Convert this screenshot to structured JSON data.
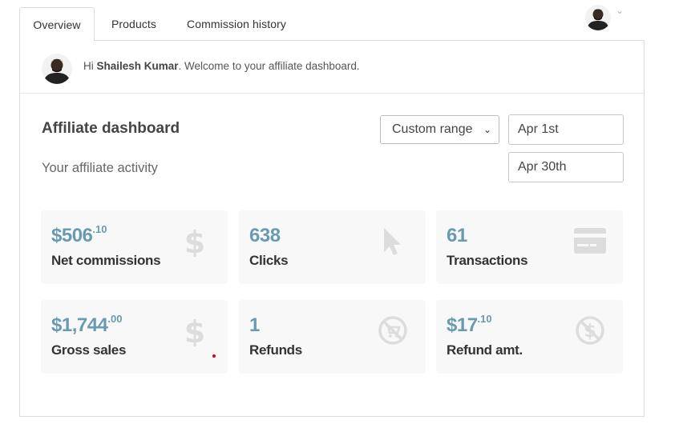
{
  "tabs": [
    {
      "label": "Overview",
      "active": true
    },
    {
      "label": "Products",
      "active": false
    },
    {
      "label": "Commission history",
      "active": false
    }
  ],
  "welcome": {
    "greeting": "Hi ",
    "user_name": "Shailesh Kumar",
    "message": ". Welcome to your affiliate dashboard."
  },
  "dashboard": {
    "title": "Affiliate dashboard",
    "subtitle": "Your affiliate activity",
    "range_selected": "Custom range",
    "date_from": "Apr 1st",
    "date_to": "Apr 30th"
  },
  "stats": [
    {
      "main": "$506",
      "cents": ".10",
      "label": "Net commissions",
      "icon": "dollar-icon"
    },
    {
      "main": "638",
      "cents": "",
      "label": "Clicks",
      "icon": "cursor-icon"
    },
    {
      "main": "61",
      "cents": "",
      "label": "Transactions",
      "icon": "credit-card-icon"
    },
    {
      "main": "$1,744",
      "cents": ".00",
      "label": "Gross sales",
      "icon": "dollar-icon"
    },
    {
      "main": "1",
      "cents": "",
      "label": "Refunds",
      "icon": "no-cart-icon"
    },
    {
      "main": "$17",
      "cents": ".10",
      "label": "Refund amt.",
      "icon": "no-dollar-icon"
    }
  ],
  "colors": {
    "value": "#6a9ab0",
    "card_bg": "#f8f8f8",
    "icon": "#dcdcdc"
  }
}
